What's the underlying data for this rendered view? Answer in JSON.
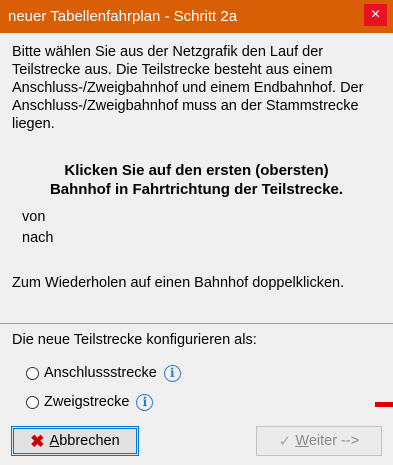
{
  "window": {
    "title": "neuer Tabellenfahrplan - Schritt 2a",
    "close_label": "×"
  },
  "intro_text": "Bitte wählen Sie aus der Netzgrafik den Lauf der Teilstrecke aus. Die Teilstrecke besteht aus einem Anschluss-/Zweigbahnhof und einem Endbahnhof. Der Anschluss-/Zweigbahnhof muss an der Stammstrecke liegen.",
  "instruction": {
    "line1": "Klicken Sie auf den ersten (obersten)",
    "line2": "Bahnhof in Fahrtrichtung der Teilstrecke."
  },
  "von_label": "von",
  "nach_label": "nach",
  "repeat_hint": "Zum Wiederholen auf einen Bahnhof doppelklicken.",
  "configure_label": "Die neue Teilstrecke konfigurieren als:",
  "options": [
    {
      "label": "Anschlussstrecke",
      "selected": false
    },
    {
      "label": "Zweigstrecke",
      "selected": false
    }
  ],
  "buttons": {
    "cancel": {
      "accel": "A",
      "rest": "bbrechen"
    },
    "next": {
      "accel": "W",
      "rest": "eiter -->"
    }
  },
  "colors": {
    "titlebar": "#d85f06",
    "close": "#e81123",
    "info": "#2b7cd3",
    "cancel_icon": "#cc0000"
  },
  "icons": {
    "cancel": "x-icon",
    "next": "checkmark-icon",
    "info": "info-icon"
  }
}
